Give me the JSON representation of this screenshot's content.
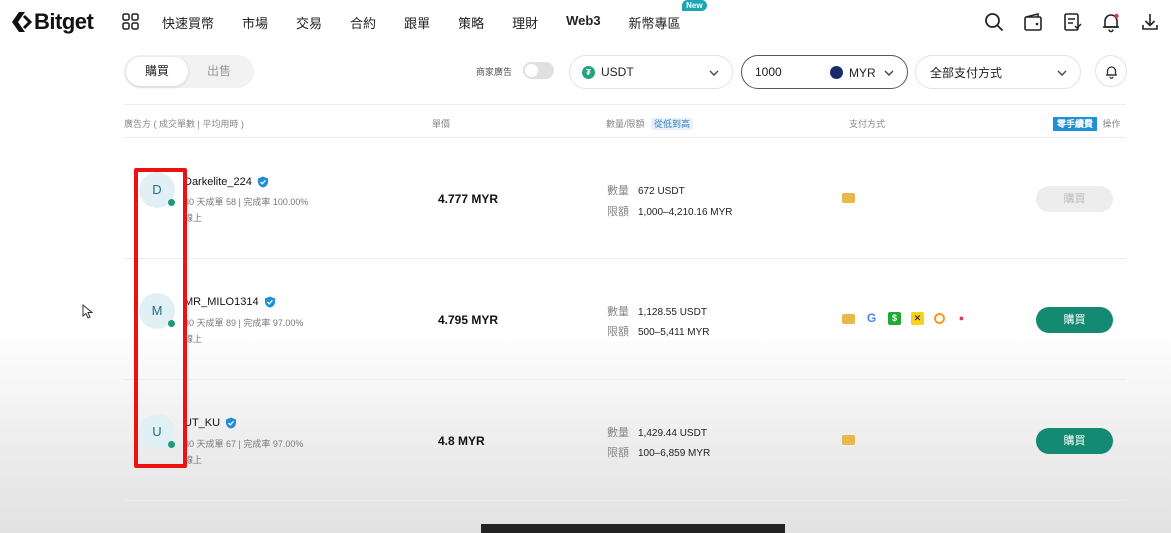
{
  "brand": {
    "name": "Bitget"
  },
  "nav": {
    "items": [
      "快速買幣",
      "市場",
      "交易",
      "合約",
      "跟單",
      "策略",
      "理財",
      "Web3",
      "新幣專區"
    ],
    "new_badge": "New"
  },
  "toolbar": {
    "tabs": [
      "購買",
      "出售"
    ],
    "active_tab": "購買",
    "merchant_label": "商家廣告",
    "coin": "USDT",
    "amount": "1000",
    "currency": "MYR",
    "payment_method": "全部支付方式"
  },
  "table": {
    "headers": {
      "advertiser": "廣告方 ( 成交單數 | 平均用時 )",
      "price": "單價",
      "quantity": "數量/限額",
      "sort": "從低到高",
      "payment": "支付方式",
      "fee": "零手續費",
      "action": "操作"
    },
    "qty_label": "數量",
    "limit_label": "限額",
    "rows": [
      {
        "avatar": "D",
        "name": "Darkelite_224",
        "stats": "30 天成單 58 | 完成率 100.00%",
        "time": "線上",
        "price": "4.777 MYR",
        "qty": "672 USDT",
        "limit": "1,000–4,210.16 MYR",
        "buy": "購買",
        "buy_enabled": false
      },
      {
        "avatar": "M",
        "name": "MR_MILO1314",
        "stats": "30 天成單 89 | 完成率 97.00%",
        "time": "線上",
        "price": "4.795 MYR",
        "qty": "1,128.55 USDT",
        "limit": "500–5,411 MYR",
        "buy": "購買",
        "buy_enabled": true
      },
      {
        "avatar": "U",
        "name": "UT_KU",
        "stats": "30 天成單 67 | 完成率 97.00%",
        "time": "線上",
        "price": "4.8 MYR",
        "qty": "1,429.44 USDT",
        "limit": "100–6,859 MYR",
        "buy": "購買",
        "buy_enabled": true
      }
    ]
  },
  "colors": {
    "accent": "#148a73",
    "highlight": "#e11111",
    "link": "#1f8fd6"
  }
}
